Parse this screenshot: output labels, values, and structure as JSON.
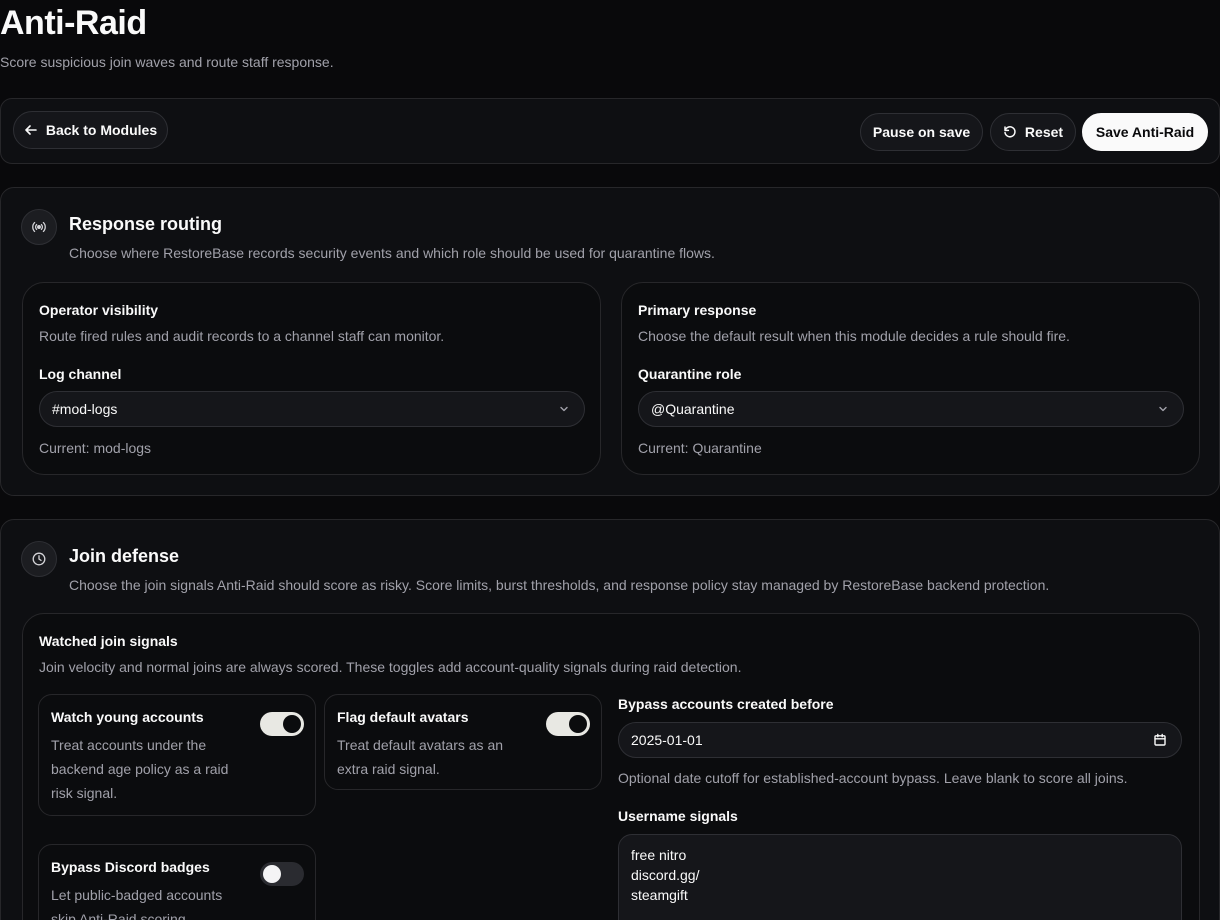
{
  "page": {
    "title": "Anti-Raid",
    "subtitle": "Score suspicious join waves and route staff response."
  },
  "toolbar": {
    "back_label": "Back to Modules",
    "pause_label": "Pause on save",
    "reset_label": "Reset",
    "save_label": "Save Anti-Raid"
  },
  "response_routing": {
    "icon": "broadcast-icon",
    "title": "Response routing",
    "description": "Choose where RestoreBase records security events and which role should be used for quarantine flows.",
    "operator_visibility": {
      "title": "Operator visibility",
      "description": "Route fired rules and audit records to a channel staff can monitor.",
      "field_label": "Log channel",
      "selected": "#mod-logs",
      "current": "Current: mod-logs"
    },
    "primary_response": {
      "title": "Primary response",
      "description": "Choose the default result when this module decides a rule should fire.",
      "field_label": "Quarantine role",
      "selected": "@Quarantine",
      "current": "Current: Quarantine"
    }
  },
  "join_defense": {
    "icon": "clock-icon",
    "title": "Join defense",
    "description": "Choose the join signals Anti-Raid should score as risky. Score limits, burst thresholds, and response policy stay managed by RestoreBase backend protection.",
    "watched": {
      "title": "Watched join signals",
      "description": "Join velocity and normal joins are always scored. These toggles add account-quality signals during raid detection."
    },
    "toggles": {
      "young_accounts": {
        "title": "Watch young accounts",
        "description": "Treat accounts under the backend age policy as a raid risk signal.",
        "enabled": true
      },
      "default_avatars": {
        "title": "Flag default avatars",
        "description": "Treat default avatars as an extra raid signal.",
        "enabled": true
      },
      "discord_badges": {
        "title": "Bypass Discord badges",
        "description": "Let public-badged accounts skip Anti-Raid scoring.",
        "enabled": false
      }
    },
    "bypass": {
      "label": "Bypass accounts created before",
      "value": "2025-01-01",
      "hint": "Optional date cutoff for established-account bypass. Leave blank to score all joins."
    },
    "username_signals": {
      "label": "Username signals",
      "lines": [
        "free nitro",
        "discord.gg/",
        "steamgift"
      ]
    }
  }
}
